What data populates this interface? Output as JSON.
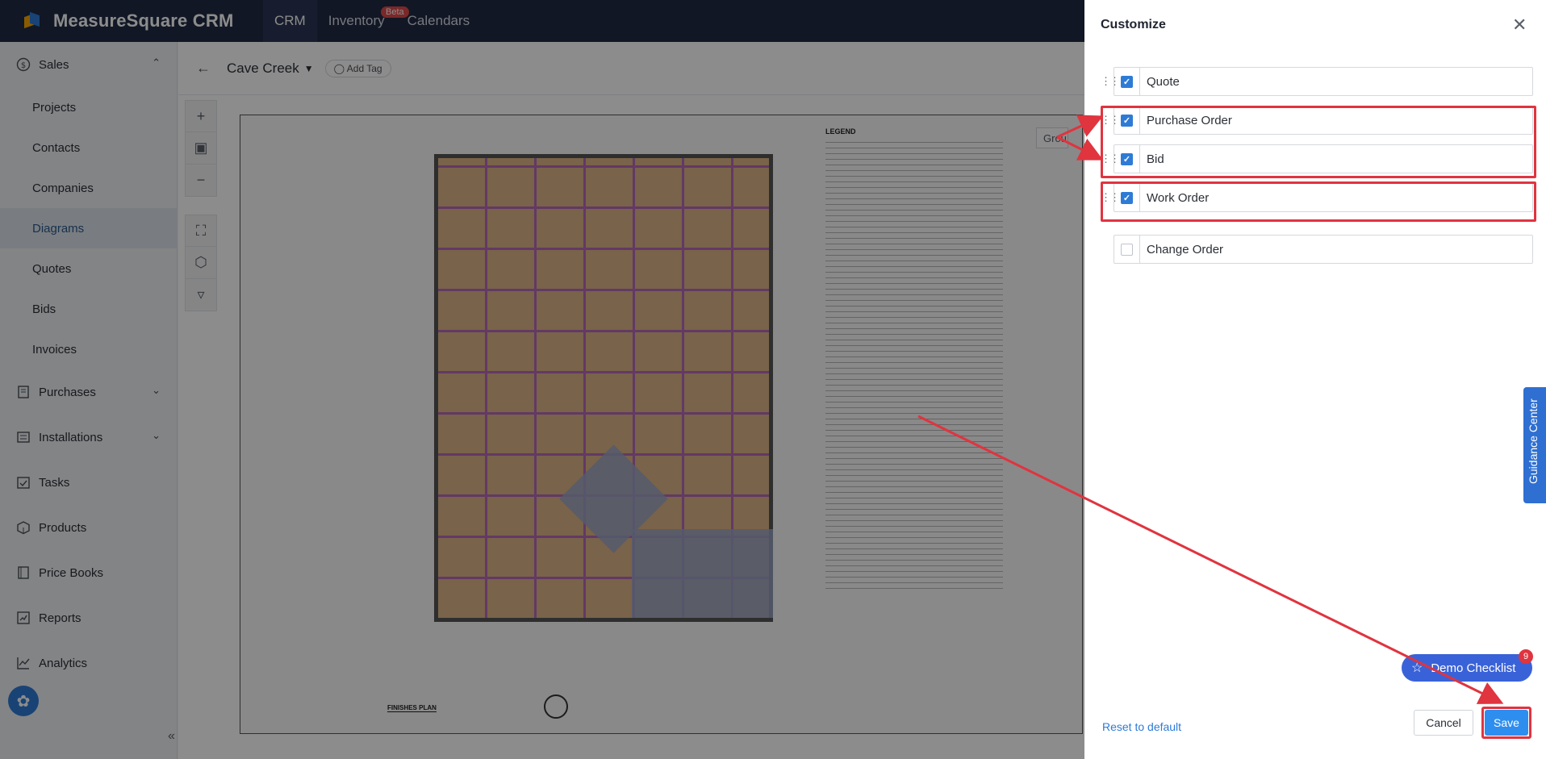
{
  "app": {
    "name": "MeasureSquare CRM"
  },
  "topnav": [
    {
      "label": "CRM",
      "active": true
    },
    {
      "label": "Inventory",
      "badge": "Beta"
    },
    {
      "label": "Calendars"
    }
  ],
  "sidebar": {
    "groups": [
      {
        "label": "Sales",
        "icon": "dollar-circle-icon",
        "expanded": true
      },
      {
        "label": "Purchases",
        "icon": "receipt-icon"
      },
      {
        "label": "Installations",
        "icon": "list-icon"
      },
      {
        "label": "Tasks",
        "icon": "calendar-check-icon"
      },
      {
        "label": "Products",
        "icon": "box-icon"
      },
      {
        "label": "Price Books",
        "icon": "book-icon"
      },
      {
        "label": "Reports",
        "icon": "report-icon"
      },
      {
        "label": "Analytics",
        "icon": "chart-line-icon"
      }
    ],
    "sales_items": [
      "Projects",
      "Contacts",
      "Companies",
      "Diagrams",
      "Quotes",
      "Bids",
      "Invoices"
    ],
    "active_item": "Diagrams"
  },
  "main": {
    "project_name": "Cave Creek",
    "add_tag_label": "Add Tag",
    "group_tab_label": "Grou",
    "legend_title": "LEGEND",
    "plan_caption": "FINISHES PLAN"
  },
  "panel": {
    "title": "Customize",
    "options": [
      {
        "label": "Quote",
        "checked": true
      },
      {
        "label": "Purchase Order",
        "checked": true
      },
      {
        "label": "Bid",
        "checked": true
      },
      {
        "label": "Work Order",
        "checked": true
      },
      {
        "label": "Change Order",
        "checked": false
      }
    ],
    "reset_label": "Reset to default",
    "cancel_label": "Cancel",
    "save_label": "Save"
  },
  "demo_checklist": {
    "label": "Demo Checklist",
    "badge": "9"
  },
  "guidance_center": {
    "label": "Guidance Center"
  },
  "colors": {
    "accent": "#2e7bd6",
    "topbar": "#1f2a44",
    "highlight": "#e0343f"
  }
}
